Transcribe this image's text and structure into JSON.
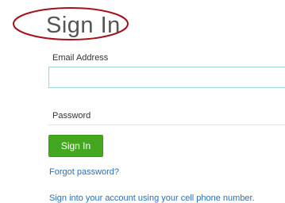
{
  "page": {
    "title": "Sign In"
  },
  "form": {
    "email_label": "Email Address",
    "email_value": "",
    "password_label": "Password",
    "submit_label": "Sign In"
  },
  "links": {
    "forgot_password": "Forgot password?",
    "phone_signin": "Sign into your account using your cell phone number."
  },
  "colors": {
    "title_annotation": "#a3121c",
    "button": "#43a820",
    "link": "#2a6fb8",
    "input_focus_border": "#9fd6d6"
  }
}
